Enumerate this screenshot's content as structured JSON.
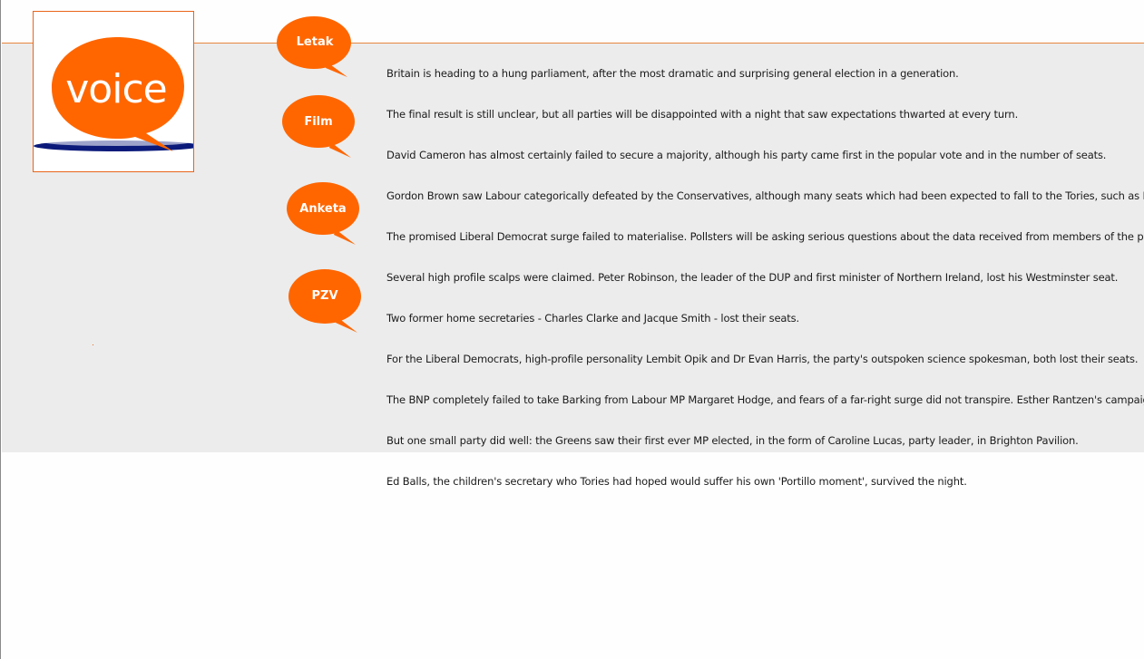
{
  "logo": {
    "text": "voice",
    "colors": {
      "bubble": "#ff6600",
      "shadow": "#0b1a7a",
      "border": "#e8651a"
    }
  },
  "nav": {
    "items": [
      {
        "label": "Letak"
      },
      {
        "label": "Film"
      },
      {
        "label": "Anketa"
      },
      {
        "label": "PZV"
      }
    ],
    "color": "#ff6600"
  },
  "news": {
    "items": [
      "Britain is heading to a hung parliament, after the most dramatic and surprising general election in a generation.",
      "The final result is still unclear, but all parties will be disappointed with a night that saw expectations thwarted at every turn.",
      "David Cameron has almost certainly failed to secure a majority, although his party came first in the popular vote and in the number of seats.",
      "Gordon Brown saw Labour categorically defeated by the Conservatives, although many seats which had been expected to fall to the Tories, such as Hamm",
      "The promised Liberal Democrat surge failed to materialise. Pollsters will be asking serious questions about the data received from members of the publi",
      "Several high profile scalps were claimed. Peter Robinson, the leader of the DUP and first minister of Northern Ireland, lost his Westminster seat.",
      "Two former home secretaries - Charles Clarke and Jacque Smith - lost their seats.",
      "For the Liberal Democrats, high-profile personality Lembit Opik and Dr Evan Harris, the party's outspoken science spokesman, both lost their seats.",
      "The BNP completely failed to take Barking from Labour MP Margaret Hodge, and fears of a far-right surge did not transpire. Esther Rantzen's campaign as",
      "But one small party did well: the Greens saw their first ever MP elected, in the form of Caroline Lucas, party leader, in Brighton Pavilion.",
      "Ed Balls, the children's secretary who Tories had hoped would suffer his own 'Portillo moment', survived the night."
    ]
  }
}
